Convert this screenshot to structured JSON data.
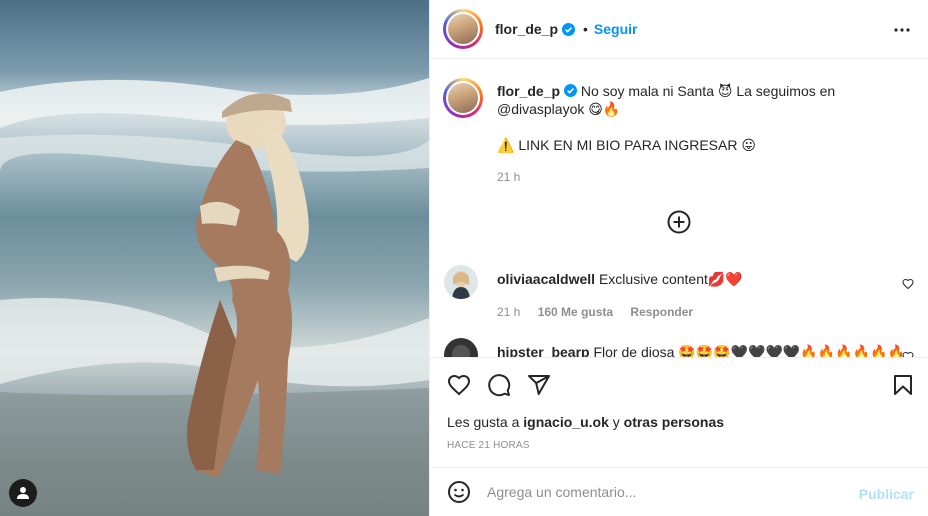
{
  "post": {
    "image_alt": "Foto de la publicación",
    "author": {
      "username": "flor_de_p",
      "verified": true,
      "follow_label": "Seguir",
      "separator": "•"
    },
    "caption": {
      "username": "flor_de_p",
      "text_line1": "No soy mala ni Santa 😈 La seguimos en",
      "text_line2": "@divasplayok 😋🔥",
      "text_line3": "⚠️ LINK EN MI BIO PARA INGRESAR 😛",
      "time": "21 h"
    },
    "comments": [
      {
        "username": "oliviaacaldwell",
        "text": "Exclusive content💋❤️",
        "time": "21 h",
        "likes": "160 Me gusta",
        "reply_label": "Responder"
      },
      {
        "username": "hipster_bearp",
        "text": "Flor de diosa 🤩🤩🤩🖤🖤🖤🖤🔥🔥🔥🔥🔥🔥"
      }
    ],
    "likes_text": {
      "prefix": "Les gusta a",
      "user": "ignacio_u.ok",
      "middle": "y",
      "others": "otras personas"
    },
    "timestamp": "HACE 21 HORAS",
    "comment_input": {
      "placeholder": "Agrega un comentario...",
      "publish_label": "Publicar"
    }
  },
  "icons": {
    "more": "more-horizontal-icon",
    "add": "plus-circle-icon",
    "like": "heart-icon",
    "comment": "comment-icon",
    "share": "send-icon",
    "save": "bookmark-icon",
    "emoji": "emoji-icon",
    "user_tag": "user-icon",
    "verified": "verified-badge-icon"
  },
  "colors": {
    "link_blue": "#0095f6",
    "publish_disabled": "#b2dffc",
    "secondary_text": "#8e8e8e",
    "primary_text": "#262626",
    "border": "#efefef"
  }
}
